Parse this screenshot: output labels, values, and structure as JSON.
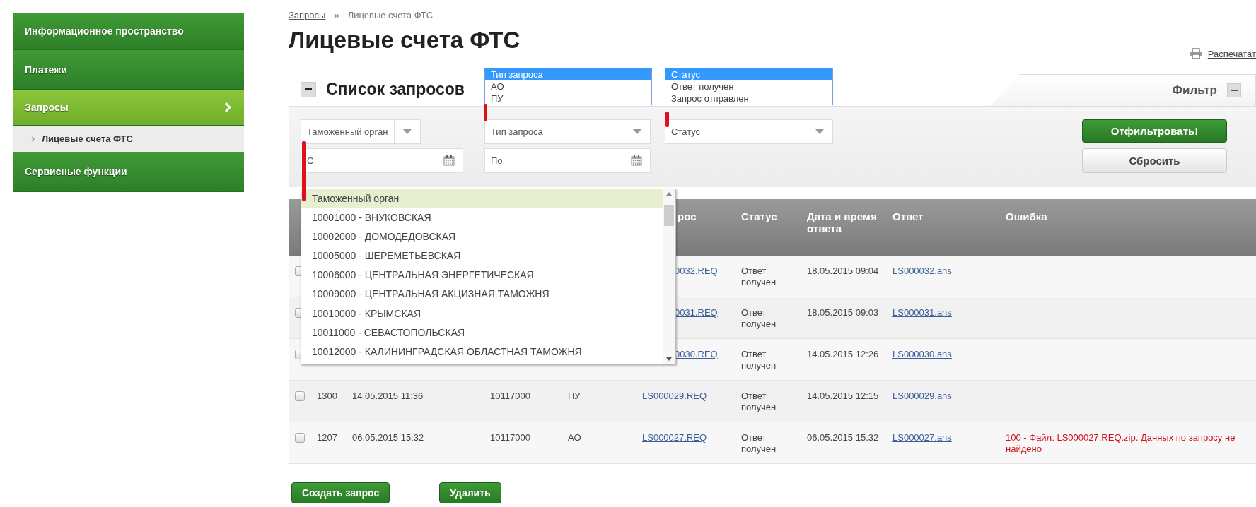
{
  "sidebar": {
    "items": [
      {
        "label": "Информационное пространство",
        "selected": false
      },
      {
        "label": "Платежи",
        "selected": false
      },
      {
        "label": "Запросы",
        "selected": true,
        "children": [
          {
            "label": "Лицевые счета ФТС",
            "selected": true
          }
        ]
      },
      {
        "label": "Сервисные функции",
        "selected": false
      }
    ]
  },
  "breadcrumb": {
    "items": [
      "Запросы",
      "Лицевые счета ФТС"
    ],
    "separator": "»"
  },
  "title": "Лицевые счета ФТС",
  "print_link": "Распечатат",
  "section": {
    "title": "Список запросов"
  },
  "filter": {
    "tab_label": "Фильтр",
    "selects": [
      {
        "placeholder": "Таможенный орган"
      },
      {
        "placeholder": "Тип запроса"
      },
      {
        "placeholder": "Статус"
      }
    ],
    "dates": [
      {
        "placeholder": "С"
      },
      {
        "placeholder": "По"
      }
    ],
    "buttons": [
      {
        "label": "Отфильтровать!",
        "kind": "primary"
      },
      {
        "label": "Сбросить",
        "kind": "secondary"
      }
    ]
  },
  "table": {
    "columns": [
      null,
      null,
      null,
      null,
      "рос",
      "Статус",
      "Дата и время ответа",
      "Ответ",
      "Ошибка"
    ],
    "rows": [
      {
        "checked": false,
        "cells": [
          null,
          null,
          null,
          null,
          {
            "text": "0032.REQ",
            "kind": "link"
          },
          {
            "text": "Ответ получен",
            "kind": "text"
          },
          {
            "text": "18.05.2015 09:04",
            "kind": "text"
          },
          {
            "text": "LS000032.ans",
            "kind": "link"
          }
        ]
      },
      {
        "checked": false,
        "cells": [
          null,
          null,
          null,
          null,
          {
            "text": "0031.REQ",
            "kind": "link"
          },
          {
            "text": "Ответ получен",
            "kind": "text"
          },
          {
            "text": "18.05.2015 09:03",
            "kind": "text"
          },
          {
            "text": "LS000031.ans",
            "kind": "link"
          }
        ]
      },
      {
        "checked": false,
        "cells": [
          null,
          null,
          null,
          null,
          {
            "text": "0030.REQ",
            "kind": "link"
          },
          {
            "text": "Ответ получен",
            "kind": "text"
          },
          {
            "text": "14.05.2015 12:26",
            "kind": "text"
          },
          {
            "text": "LS000030.ans",
            "kind": "link"
          }
        ]
      },
      {
        "checked": false,
        "cells": [
          {
            "text": "1300",
            "kind": "text"
          },
          {
            "text": "14.05.2015 11:36",
            "kind": "text"
          },
          {
            "text": "10117000",
            "kind": "text"
          },
          {
            "text": "ПУ",
            "kind": "text"
          },
          {
            "text": "LS000029.REQ",
            "kind": "link"
          },
          {
            "text": "Ответ получен",
            "kind": "text"
          },
          {
            "text": "14.05.2015 12:15",
            "kind": "text"
          },
          {
            "text": "LS000029.ans",
            "kind": "link"
          }
        ]
      },
      {
        "checked": false,
        "cells": [
          {
            "text": "1207",
            "kind": "text"
          },
          {
            "text": "06.05.2015 15:32",
            "kind": "text"
          },
          {
            "text": "10117000",
            "kind": "text"
          },
          {
            "text": "АО",
            "kind": "text"
          },
          {
            "text": "LS000027.REQ",
            "kind": "link"
          },
          {
            "text": "Ответ получен",
            "kind": "text"
          },
          {
            "text": "06.05.2015 15:32",
            "kind": "text"
          },
          {
            "text": "LS000027.ans",
            "kind": "link"
          },
          {
            "text": "100 - Файл: LS000027.REQ.zip. Данных по запросу не найдено",
            "kind": "error"
          }
        ]
      }
    ]
  },
  "actions": [
    {
      "label": "Создать запрос"
    },
    {
      "label": "Удалить"
    }
  ],
  "type_list": {
    "options": [
      {
        "label": "Тип запроса",
        "selected": true
      },
      {
        "label": "АО",
        "selected": false
      },
      {
        "label": "ПУ",
        "selected": false
      }
    ]
  },
  "status_list": {
    "options": [
      {
        "label": "Статус",
        "selected": true
      },
      {
        "label": "Ответ получен",
        "selected": false
      },
      {
        "label": "Запрос отправлен",
        "selected": false
      }
    ]
  },
  "customs_list": {
    "options": [
      {
        "label": "Таможенный орган",
        "selected": true
      },
      {
        "label": "10001000 - ВНУКОВСКАЯ",
        "selected": false
      },
      {
        "label": "10002000 - ДОМОДЕДОВСКАЯ",
        "selected": false
      },
      {
        "label": "10005000 - ШЕРЕМЕТЬЕВСКАЯ",
        "selected": false
      },
      {
        "label": "10006000 - ЦЕНТРАЛЬНАЯ ЭНЕРГЕТИЧЕСКАЯ",
        "selected": false
      },
      {
        "label": "10009000 - ЦЕНТРАЛЬНАЯ АКЦИЗНАЯ ТАМОЖНЯ",
        "selected": false
      },
      {
        "label": "10010000 - КРЫМСКАЯ",
        "selected": false
      },
      {
        "label": "10011000 - СЕВАСТОПОЛЬСКАЯ",
        "selected": false
      },
      {
        "label": "10012000 - КАЛИНИНГРАДСКАЯ ОБЛАСТНАЯ ТАМОЖНЯ",
        "selected": false
      }
    ]
  }
}
